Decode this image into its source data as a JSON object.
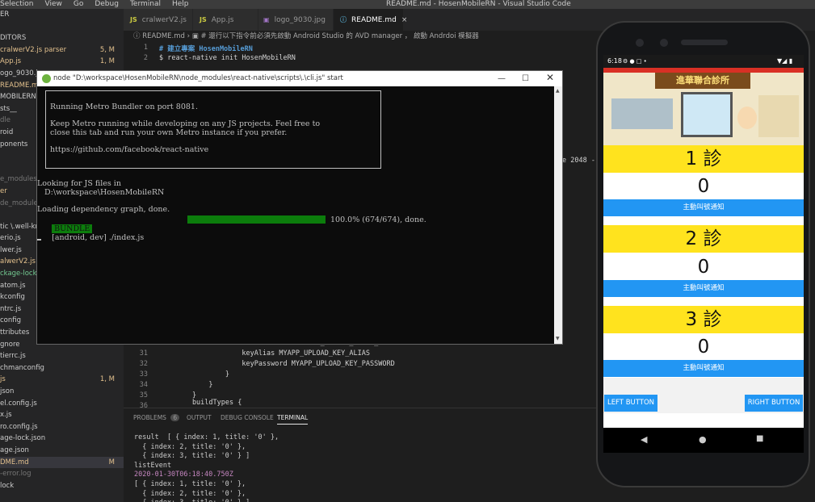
{
  "menubar": {
    "items": [
      "Selection",
      "View",
      "Go",
      "Debug",
      "Terminal",
      "Help"
    ],
    "title": "README.md - HosenMobileRN - Visual Studio Code"
  },
  "sidebar": {
    "rows": [
      {
        "text": "ER",
        "color": "#ccc",
        "badge": ""
      },
      {
        "text": "",
        "color": "#ccc",
        "badge": ""
      },
      {
        "text": "DITORS",
        "color": "#ccc",
        "badge": ""
      },
      {
        "text": "cralwerV2.js  parser",
        "color": "#e2c08d",
        "badge": "5, M"
      },
      {
        "text": "App.js",
        "color": "#e2c08d",
        "badge": "1, M"
      },
      {
        "text": "ogo_9030.jpg",
        "color": "#ccc",
        "badge": ""
      },
      {
        "text": "README.md",
        "color": "#e2c08d",
        "badge": ""
      },
      {
        "text": "MOBILERN",
        "color": "#ccc",
        "badge": ""
      },
      {
        "text": "sts__",
        "color": "#ccc",
        "badge": ""
      },
      {
        "text": "dle",
        "color": "#777",
        "badge": ""
      },
      {
        "text": "roid",
        "color": "#ccc",
        "badge": ""
      },
      {
        "text": "ponents",
        "color": "#ccc",
        "badge": ""
      },
      {
        "text": "",
        "color": "#ccc",
        "badge": ""
      },
      {
        "text": "",
        "color": "#ccc",
        "badge": ""
      },
      {
        "text": "e_modules",
        "color": "#777",
        "badge": ""
      },
      {
        "text": "er",
        "color": "#e2c08d",
        "badge": ""
      },
      {
        "text": "de_modules",
        "color": "#777",
        "badge": ""
      },
      {
        "text": "",
        "color": "#ccc",
        "badge": ""
      },
      {
        "text": "tic \\.well-kn",
        "color": "#ccc",
        "badge": ""
      },
      {
        "text": "erio.js",
        "color": "#ccc",
        "badge": ""
      },
      {
        "text": "lwer.js",
        "color": "#ccc",
        "badge": ""
      },
      {
        "text": "alwerV2.js",
        "color": "#e2c08d",
        "badge": ""
      },
      {
        "text": "ckage-lock.js",
        "color": "#73c991",
        "badge": ""
      },
      {
        "text": "atom.js",
        "color": "#ccc",
        "badge": ""
      },
      {
        "text": "kconfig",
        "color": "#ccc",
        "badge": ""
      },
      {
        "text": "ntrc.js",
        "color": "#ccc",
        "badge": ""
      },
      {
        "text": "config",
        "color": "#ccc",
        "badge": ""
      },
      {
        "text": "ttributes",
        "color": "#ccc",
        "badge": ""
      },
      {
        "text": "gnore",
        "color": "#ccc",
        "badge": ""
      },
      {
        "text": "tierrc.js",
        "color": "#ccc",
        "badge": ""
      },
      {
        "text": "chmanconfig",
        "color": "#ccc",
        "badge": ""
      },
      {
        "text": "js",
        "color": "#e2c08d",
        "badge": "1, M"
      },
      {
        "text": "json",
        "color": "#ccc",
        "badge": ""
      },
      {
        "text": "el.config.js",
        "color": "#ccc",
        "badge": ""
      },
      {
        "text": "x.js",
        "color": "#ccc",
        "badge": ""
      },
      {
        "text": "ro.config.js",
        "color": "#ccc",
        "badge": ""
      },
      {
        "text": "age-lock.json",
        "color": "#ccc",
        "badge": ""
      },
      {
        "text": "age.json",
        "color": "#ccc",
        "badge": ""
      },
      {
        "text": "DME.md",
        "color": "#e2c08d",
        "badge": "M"
      },
      {
        "text": "-error.log",
        "color": "#777",
        "badge": ""
      },
      {
        "text": "lock",
        "color": "#ccc",
        "badge": ""
      }
    ]
  },
  "tabs": [
    {
      "icon": "JS",
      "icon_color": "#cbcb41",
      "label": "cralwerV2.js"
    },
    {
      "icon": "JS",
      "icon_color": "#cbcb41",
      "label": "App.js"
    },
    {
      "icon": "▣",
      "icon_color": "#a074c4",
      "label": "logo_9030.jpg"
    },
    {
      "icon": "ⓘ",
      "icon_color": "#519aba",
      "label": "README.md",
      "close": "×"
    }
  ],
  "breadcrumb": "ⓘ README.md › ▣ # 還行以下指令前必須先啟動 Android Studio 的 AVD manager ， 啟動 Andrdoi 模擬器",
  "code_top": [
    {
      "num": "1",
      "text": "# 建立專案 HosenMobileRN"
    },
    {
      "num": "2",
      "text": "$ react-native init HosenMobileRN"
    }
  ],
  "code_peek": "e 2048 -",
  "code_bottom": [
    {
      "num": "",
      "text": "                    storePassword MYAPP_UPLOAD_STORE_PASSWORD"
    },
    {
      "num": "31",
      "text": "                    keyAlias MYAPP_UPLOAD_KEY_ALIAS"
    },
    {
      "num": "32",
      "text": "                    keyPassword MYAPP_UPLOAD_KEY_PASSWORD"
    },
    {
      "num": "33",
      "text": "                }"
    },
    {
      "num": "34",
      "text": "            }"
    },
    {
      "num": "35",
      "text": "        }"
    },
    {
      "num": "36",
      "text": "        buildTypes {"
    }
  ],
  "panel": {
    "tabs": [
      {
        "label": "PROBLEMS",
        "badge": "6"
      },
      {
        "label": "OUTPUT"
      },
      {
        "label": "DEBUG CONSOLE"
      },
      {
        "label": "TERMINAL"
      }
    ],
    "lines": [
      {
        "text": "result  [ { index: 1, title: '0' },",
        "color": "#ccc"
      },
      {
        "text": "  { index: 2, title: '0' },",
        "color": "#ccc"
      },
      {
        "text": "  { index: 3, title: '0' } ]",
        "color": "#ccc"
      },
      {
        "text": "listEvent",
        "color": "#ccc"
      },
      {
        "text": "2020-01-30T06:18:40.750Z",
        "color": "#c586c0"
      },
      {
        "text": "[ { index: 1, title: '0' },",
        "color": "#ccc"
      },
      {
        "text": "  { index: 2, title: '0' },",
        "color": "#ccc"
      },
      {
        "text": "  { index: 3, title: '0' } ]",
        "color": "#ccc"
      }
    ]
  },
  "cmd": {
    "title": "node \"D:\\workspace\\HosenMobileRN\\node_modules\\react-native\\scripts\\.\\cli.js\" start",
    "box_lines": [
      "Running Metro Bundler on port 8081.",
      "",
      "Keep Metro running while developing on any JS projects. Feel free to",
      "close this tab and run your own Metro instance if you prefer.",
      "",
      "https://github.com/facebook/react-native"
    ],
    "after_lines": [
      "Looking for JS files in",
      "   D:\\workspace\\HosenMobileRN",
      "",
      "Loading dependency graph, done."
    ],
    "bundle_tag": " BUNDLE ",
    "bundle_text": "[android, dev] ./index.js",
    "progress": 1.0,
    "progress_text": "100.0% (674/674), done."
  },
  "phone": {
    "time": "6:18",
    "status_right": "▼◢ ▮",
    "banner_title": "進華聯合診所",
    "clinics": [
      {
        "label": "1 診",
        "count": "0",
        "button": "主動叫號通知"
      },
      {
        "label": "2 診",
        "count": "0",
        "button": "主動叫號通知"
      },
      {
        "label": "3 診",
        "count": "0",
        "button": "主動叫號通知"
      }
    ],
    "left_button": "LEFT BUTTON",
    "right_button": "RIGHT BUTTON",
    "nav": {
      "back": "◀",
      "home": "●",
      "recent": "■"
    }
  },
  "colors": {
    "accent": "#2296f3",
    "yellow": "#ffe31e",
    "bundle_green": "#0c7d0c"
  }
}
